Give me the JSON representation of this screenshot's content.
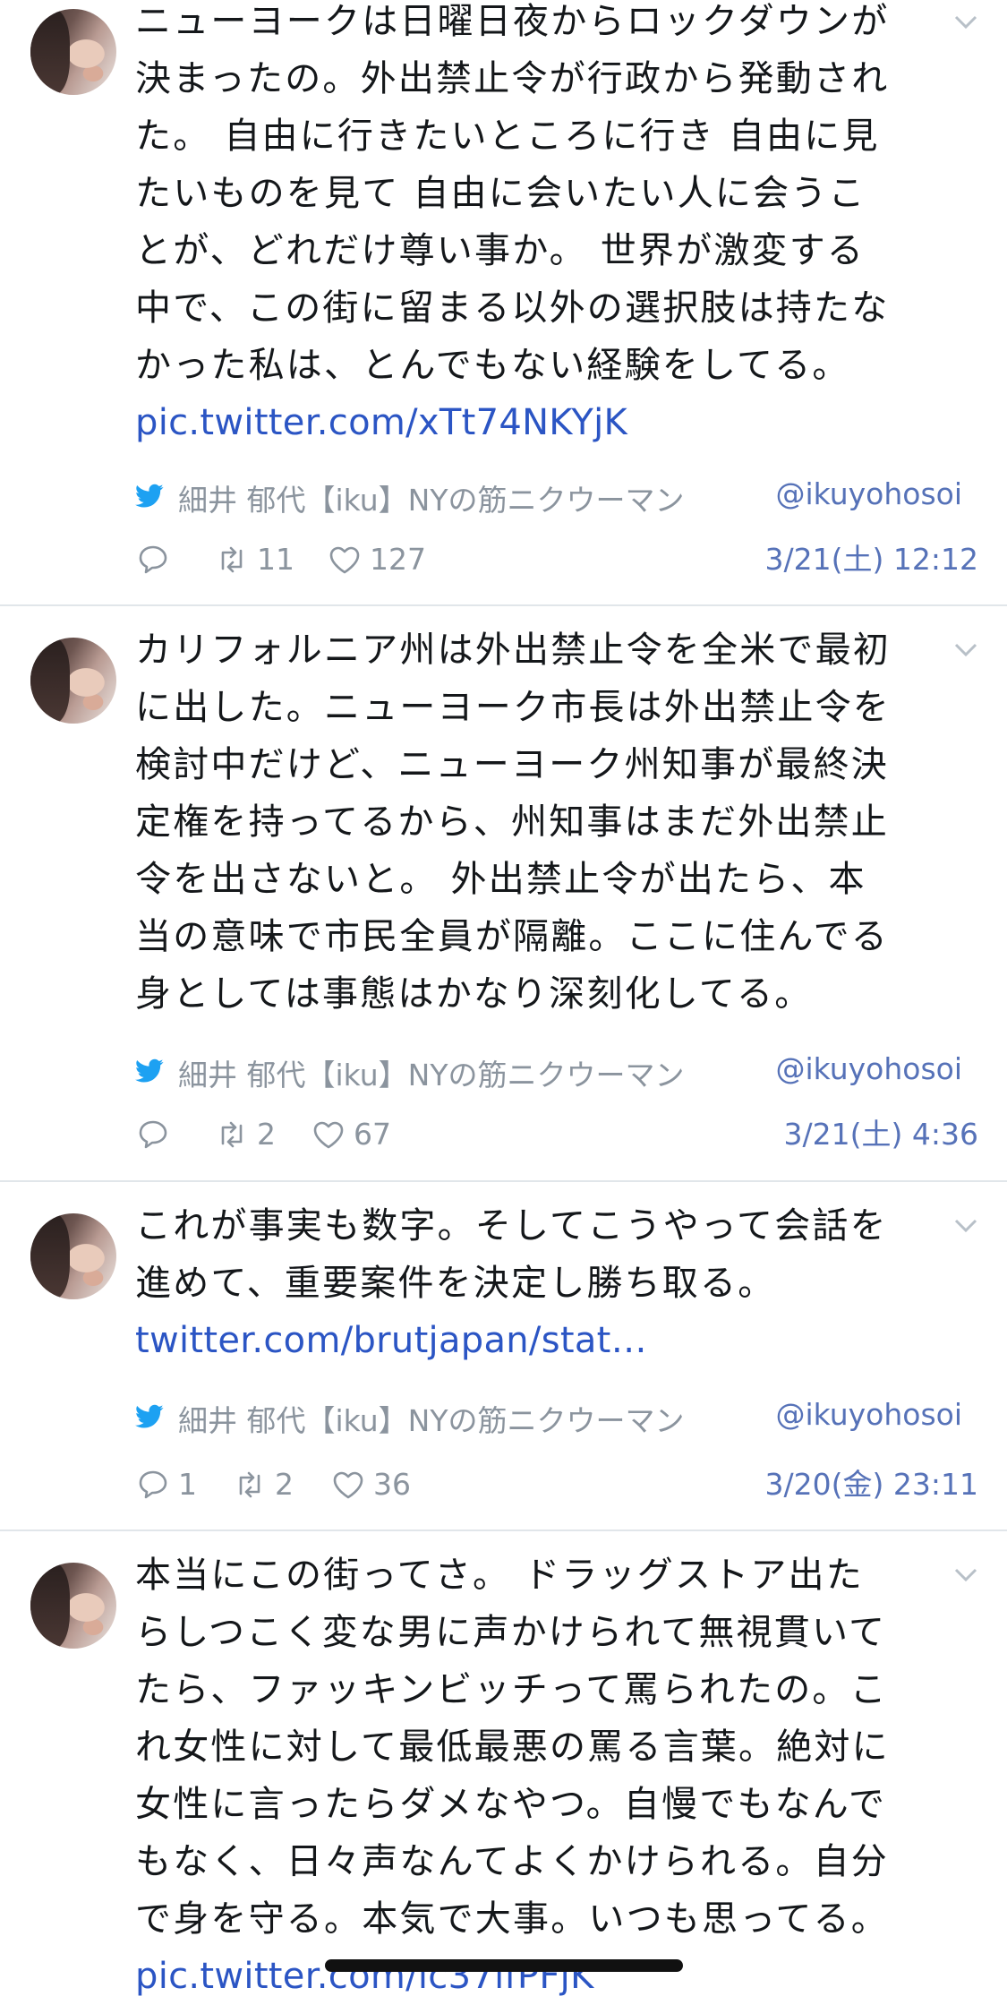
{
  "tweets": [
    {
      "text": "ニューヨークは日曜日夜からロックダウンが\n決まったの。外出禁止令が行政から発動され\nた。 自由に行きたいところに行き 自由に見\nたいものを見て 自由に会いたい人に会うこ\nとが、どれだけ尊い事か。 世界が激変する\n中で、この街に留まる以外の選択肢は持たな\nかった私は、とんでもない経験をしてる。",
      "link": "pic.twitter.com/xTt74NKYjK",
      "author": "細井 郁代【iku】NYの筋ニクウーマン",
      "handle": "@ikuyohosoi",
      "replies": "",
      "retweets": "11",
      "likes": "127",
      "time": "3/21(土) 12:12"
    },
    {
      "text": "カリフォルニア州は外出禁止令を全米で最初\nに出した。ニューヨーク市長は外出禁止令を\n検討中だけど、ニューヨーク州知事が最終決\n定権を持ってるから、州知事はまだ外出禁止\n令を出さないと。 外出禁止令が出たら、本\n当の意味で市民全員が隔離。ここに住んでる\n身としては事態はかなり深刻化してる。",
      "link": "",
      "author": "細井 郁代【iku】NYの筋ニクウーマン",
      "handle": "@ikuyohosoi",
      "replies": "",
      "retweets": "2",
      "likes": "67",
      "time": "3/21(土) 4:36"
    },
    {
      "text": "これが事実も数字。そしてこうやって会話を\n進めて、重要案件を決定し勝ち取る。",
      "link": "twitter.com/brutjapan/stat…",
      "author": "細井 郁代【iku】NYの筋ニクウーマン",
      "handle": "@ikuyohosoi",
      "replies": "1",
      "retweets": "2",
      "likes": "36",
      "time": "3/20(金) 23:11"
    },
    {
      "text": "本当にこの街ってさ。 ドラッグストア出た\nらしつこく変な男に声かけられて無視貫いて\nたら、ファッキンビッチって罵られたの。こ\nれ女性に対して最低最悪の罵る言葉。絶対に\n女性に言ったらダメなやつ。自慢でもなんで\nもなく、日々声なんてよくかけられる。自分\nで身を守る。本気で大事。いつも思ってる。",
      "link": "pic.twitter.com/lc37ifPFjK"
    }
  ],
  "colors": {
    "link": "#2b55c4",
    "meta_blue": "#5672b8",
    "twitter_bird": "#1da1f2",
    "muted_gray": "#8b949e",
    "divider": "#e1e6ea"
  },
  "icons": [
    "twitter-bird-icon",
    "reply-icon",
    "retweet-icon",
    "like-icon",
    "chevron-down-icon",
    "avatar"
  ]
}
